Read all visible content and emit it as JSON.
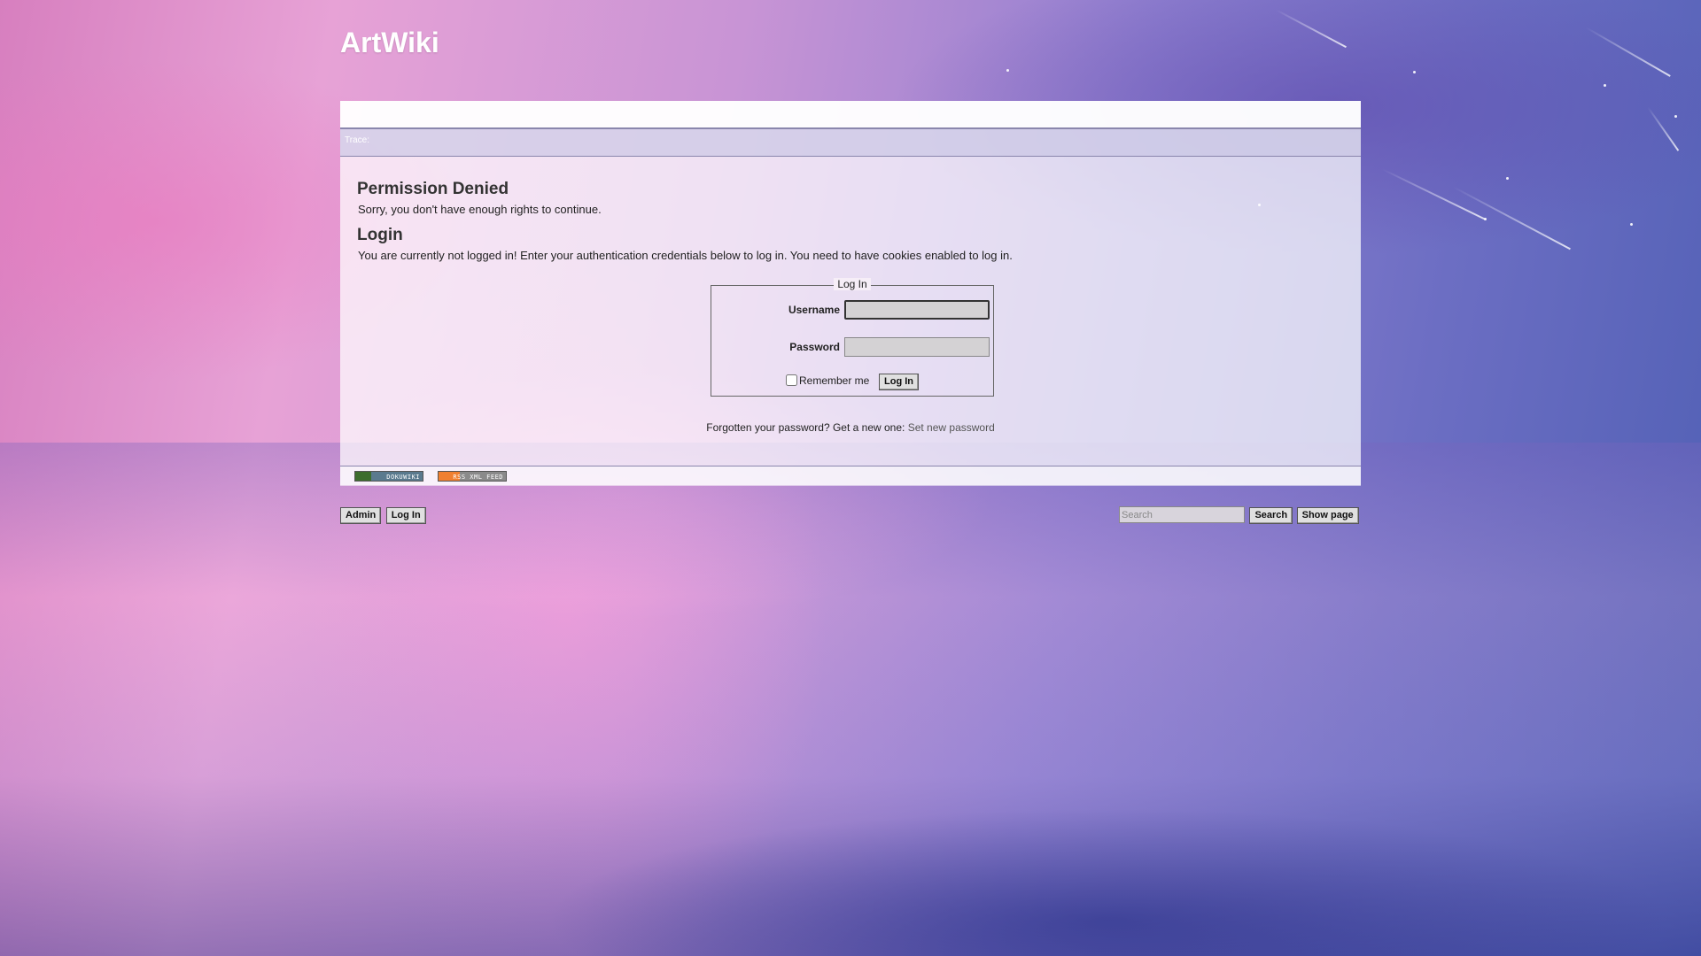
{
  "site": {
    "title": "ArtWiki"
  },
  "trace": {
    "label": "Trace:"
  },
  "content": {
    "heading_denied": "Permission Denied",
    "text_denied": "Sorry, you don't have enough rights to continue.",
    "heading_login": "Login",
    "text_login": "You are currently not logged in! Enter your authentication credentials below to log in. You need to have cookies enabled to log in."
  },
  "login_form": {
    "legend": "Log In",
    "username_label": "Username",
    "username_value": "",
    "password_label": "Password",
    "password_value": "",
    "remember_label": "Remember me",
    "remember_checked": false,
    "submit_label": "Log In"
  },
  "forgot": {
    "text": "Forgotten your password? Get a new one: ",
    "link_label": "Set new password"
  },
  "footer_badges": {
    "dokuwiki": "DOKUWIKI",
    "rss": "RSS XML FEED"
  },
  "bottom_nav": {
    "admin_label": "Admin",
    "login_label": "Log In",
    "search_placeholder": "Search",
    "search_label": "Search",
    "show_page_label": "Show page"
  },
  "colors": {
    "panel_border": "#8a86ad",
    "button_bg": "#e0e0e0",
    "link": "#555555"
  }
}
